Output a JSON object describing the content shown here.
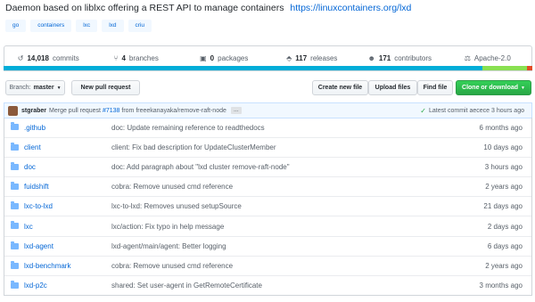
{
  "repo": {
    "description": "Daemon based on liblxc offering a REST API to manage containers",
    "url": "https://linuxcontainers.org/lxd"
  },
  "topics": [
    "go",
    "containers",
    "lxc",
    "lxd",
    "criu"
  ],
  "summary": {
    "commits": {
      "count": "14,018",
      "label": "commits",
      "icon": "history-icon"
    },
    "branches": {
      "count": "4",
      "label": "branches",
      "icon": "branch-icon"
    },
    "packages": {
      "count": "0",
      "label": "packages",
      "icon": "package-icon"
    },
    "releases": {
      "count": "117",
      "label": "releases",
      "icon": "tag-icon"
    },
    "contributors": {
      "count": "171",
      "label": "contributors",
      "icon": "people-icon"
    },
    "license": {
      "label": "Apache-2.0",
      "icon": "law-icon"
    }
  },
  "language_bar": [
    {
      "color": "#00add8",
      "fraction": 0.905
    },
    {
      "color": "#89e051",
      "fraction": 0.085
    },
    {
      "color": "#e34c26",
      "fraction": 0.01
    }
  ],
  "toolbar": {
    "branch_prefix": "Branch:",
    "branch_name": "master",
    "new_pull_request": "New pull request",
    "create_new_file": "Create new file",
    "upload_files": "Upload files",
    "find_file": "Find file",
    "clone_download": "Clone or download"
  },
  "latest_commit": {
    "author": "stgraber",
    "message_prefix": "Merge pull request",
    "pr_link": "#7138",
    "message_suffix": "from freeekanayaka/remove-raft-node",
    "ellipsis": "…",
    "status_text": "Latest commit aecece 3 hours ago"
  },
  "files": [
    {
      "name": ".github",
      "message": "doc: Update remaining reference to readthedocs",
      "age": "6 months ago"
    },
    {
      "name": "client",
      "message": "client: Fix bad description for UpdateClusterMember",
      "age": "10 days ago"
    },
    {
      "name": "doc",
      "message": "doc: Add paragraph about \"lxd cluster remove-raft-node\"",
      "age": "3 hours ago"
    },
    {
      "name": "fuidshift",
      "message": "cobra: Remove unused cmd reference",
      "age": "2 years ago"
    },
    {
      "name": "lxc-to-lxd",
      "message": "lxc-to-lxd: Removes unused setupSource",
      "age": "21 days ago"
    },
    {
      "name": "lxc",
      "message": "lxc/action: Fix typo in help message",
      "age": "2 days ago"
    },
    {
      "name": "lxd-agent",
      "message": "lxd-agent/main/agent: Better logging",
      "age": "6 days ago"
    },
    {
      "name": "lxd-benchmark",
      "message": "cobra: Remove unused cmd reference",
      "age": "2 years ago"
    },
    {
      "name": "lxd-p2c",
      "message": "shared: Set user-agent in GetRemoteCertificate",
      "age": "3 months ago"
    }
  ]
}
